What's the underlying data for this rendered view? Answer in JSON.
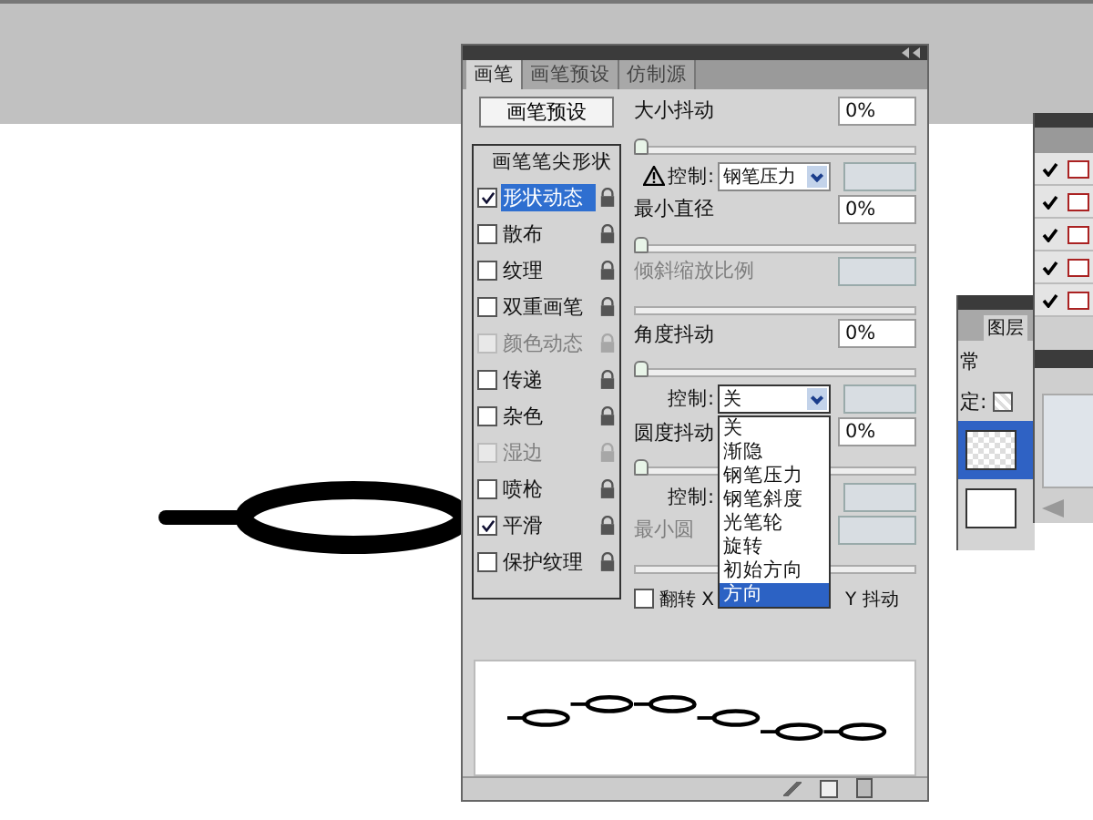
{
  "brush_panel": {
    "tabs": [
      {
        "label": "画笔",
        "selected": true
      },
      {
        "label": "画笔预设",
        "selected": false
      },
      {
        "label": "仿制源",
        "selected": false
      }
    ],
    "preset_button": "画笔预设",
    "options": [
      {
        "kind": "heading",
        "label": "画笔笔尖形状"
      },
      {
        "kind": "option",
        "label": "形状动态",
        "checked": true,
        "selected": true,
        "disabled": false
      },
      {
        "kind": "option",
        "label": "散布",
        "checked": false,
        "selected": false,
        "disabled": false
      },
      {
        "kind": "option",
        "label": "纹理",
        "checked": false,
        "selected": false,
        "disabled": false
      },
      {
        "kind": "option",
        "label": "双重画笔",
        "checked": false,
        "selected": false,
        "disabled": false
      },
      {
        "kind": "option",
        "label": "颜色动态",
        "checked": false,
        "selected": false,
        "disabled": true
      },
      {
        "kind": "option",
        "label": "传递",
        "checked": false,
        "selected": false,
        "disabled": false
      },
      {
        "kind": "option",
        "label": "杂色",
        "checked": false,
        "selected": false,
        "disabled": false
      },
      {
        "kind": "option",
        "label": "湿边",
        "checked": false,
        "selected": false,
        "disabled": true
      },
      {
        "kind": "option",
        "label": "喷枪",
        "checked": false,
        "selected": false,
        "disabled": false
      },
      {
        "kind": "option",
        "label": "平滑",
        "checked": true,
        "selected": false,
        "disabled": false
      },
      {
        "kind": "option",
        "label": "保护纹理",
        "checked": false,
        "selected": false,
        "disabled": false
      }
    ],
    "settings": [
      {
        "kind": "jitter",
        "label": "大小抖动",
        "value": "0%",
        "level": 0
      },
      {
        "kind": "control",
        "label": "控制:",
        "warning": true,
        "select": "钢笔压力"
      },
      {
        "kind": "jitter",
        "label": "最小直径",
        "value": "0%",
        "level": 0
      },
      {
        "kind": "jitter",
        "label": "倾斜缩放比例",
        "disabled": true
      },
      {
        "kind": "jitter",
        "label": "角度抖动",
        "value": "0%",
        "level": 0
      },
      {
        "kind": "control",
        "label": "控制:",
        "select": "关",
        "open": true
      },
      {
        "kind": "jitter",
        "label": "圆度抖动",
        "value": "0%",
        "level": 0
      },
      {
        "kind": "control",
        "label": "控制:"
      },
      {
        "kind": "jitter",
        "label": "最小圆",
        "disabled": true
      },
      {
        "kind": "flip",
        "label_x": "翻转 X",
        "label_y": "Y 抖动",
        "checked": false
      }
    ],
    "dropdown": [
      {
        "label": "关",
        "selected": false
      },
      {
        "label": "渐隐",
        "selected": false
      },
      {
        "label": "钢笔压力",
        "selected": false
      },
      {
        "label": "钢笔斜度",
        "selected": false
      },
      {
        "label": "光笔轮",
        "selected": false
      },
      {
        "label": "旋转",
        "selected": false
      },
      {
        "label": "初始方向",
        "selected": false
      },
      {
        "label": "方向",
        "selected": true
      }
    ]
  },
  "layers_panel": {
    "tab": "图层",
    "blend_mode": "常",
    "lock_label": "定:"
  }
}
